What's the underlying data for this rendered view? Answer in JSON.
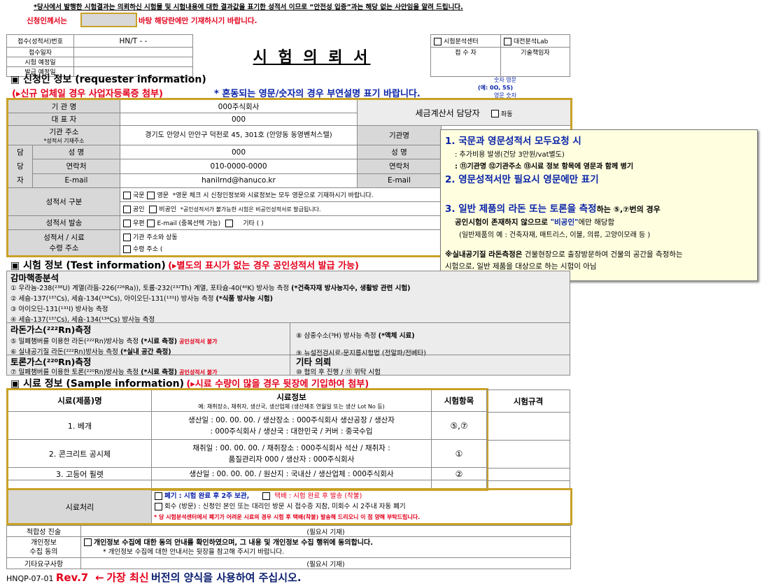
{
  "top_notice": "*당사에서 발행한 시험결과는 의뢰하신 시험물 및 시험내용에 대한 결과값을 표기한 성적서 이므로 “안전성 입증”과는 해당 없는 사안임을 알려 드립니다.",
  "applicant_note": {
    "before": "신청인께서는",
    "after": "바탕 해당란에만 기재하시기 바랍니다."
  },
  "header": {
    "receipt_no_label": "접수(성적서)번호",
    "receipt_no_value": "HN/T -        -",
    "receipt_date_label": "접수일자",
    "test_date_label": "시험 예정일",
    "issue_date_label": "발급 예정일",
    "title": "시 험 의 뢰 서",
    "center_label": "시험분석센터",
    "receiver_label": "접 수 자",
    "lab_label": "대전분석Lab",
    "tech_label": "기술책임자"
  },
  "requester_section": {
    "title": "▣ 신청인 정보 (requester information)",
    "warning": "(▸신규 업체일 경우 사업자등록증 첨부)",
    "eng_note": "* 혼동되는 영문/숫자의 경우 부연설명 표기 바랍니다.",
    "example_top": "숫자    영문",
    "example_mid": "(예: 0O,    5S)",
    "example_bottom": "영문    숫자"
  },
  "requester": {
    "org_label": "기 관 명",
    "org_value": "000주식회사",
    "ceo_label": "대 표 자",
    "ceo_value": "000",
    "addr_label": "기관 주소",
    "addr_sub": "*성적서 기재주소",
    "addr_value": "경기도 안양시 만안구 덕천로 45, 301호 (안양동 동영벤처스텔)",
    "contact_side": "담당자",
    "name_label": "성 명",
    "name_value": "000",
    "phone_label": "연락처",
    "phone_value": "010-0000-0000",
    "email_label": "E-mail",
    "email_value": "hanilrnd@hanuco.kr",
    "tax_label": "세금계산서 담당자",
    "tax_same": "좌동",
    "r_org_label": "기관명",
    "r_name_label": "성 명",
    "r_phone_label": "연락처",
    "r_email_label": "E-mail"
  },
  "report": {
    "type_label": "성적서 구분",
    "kor": "국문",
    "eng": "영문",
    "eng_note": "*영문 체크 시 신청인정보와 시료정보는 모두 영문으로 기재하시기 바랍니다.",
    "official": "공인",
    "unofficial": "비공인",
    "official_note": "*공인성적서가 불가능한 시험은 비공인성적서로 발급됩니다.",
    "send_label": "성적서 발송",
    "mail": "우편",
    "email_dup": "E-mail (중복선택 가능)",
    "other": "기타 (                    )",
    "recv_label1": "성적서 / 시료",
    "recv_label2": "수령 주소",
    "recv_opt1": "기관 주소와 상동",
    "recv_opt2": "수령 주소 ("
  },
  "popup": {
    "l1": "1. 국문과 영문성적서 모두요청 시",
    "l2": ": 추가비용 발생(건당 3만원/vat별도)",
    "l3": ": ⑪기관명  ⑫기관주소   ⑬시료 정보   항목에 영문과 함께 병기",
    "l4": "2. 영문성적서만 필요시 영문에만 표기",
    "l5a": "3. 일반 제품의 라돈 또는 토론을 측정",
    "l5b": "하는 ⑤,⑦번의 경우",
    "l6a": "공인시험이 존재하지 않으므로 ",
    "l6b": "\"비공인\"",
    "l6c": "에만 해당함",
    "l7": "(일반제품의 예 : 건축자재, 매트리스, 이불, 의류, 고양이모래 등 )",
    "l8a": "※실내공기질 라돈측정은",
    "l8b": " 건물현장으로 출장방문하여 건물의 공간을 측정하는",
    "l9": "시험으로, 일반 제품을 대상으로 하는 시험이 아님"
  },
  "test_section": {
    "title": "▣ 시험 정보 (Test information)",
    "note": "(▸별도의 표시가 없는 경우 공인성적서 발급 가능)",
    "gamma_title": "감마핵종분석",
    "g1a": "① 우라늄-238(²³⁸U) 계열(라듐-226(²²⁶Ra)), 토륨-232(²³²Th) 계열, 포타슘-40(⁴⁰K) 방사능 측정 ",
    "g1b": "(*건축자재 방사능지수, 생활방 관련 시험)",
    "g2a": "② 세슘-137(¹³⁷Cs), 세슘-134(¹³⁴Cs), 아이오딘-131(¹³¹I) 방사능 측정 ",
    "g2b": "(*식품 방사능 시험)",
    "g3": "③ 아이오딘-131(¹³¹I) 방사능 측정",
    "g4": "④ 세슘-137(¹³⁷Cs), 세슘-134(¹³⁴Cs) 방사능 측정",
    "radon_title": "라돈가스(²²²Rn)측정",
    "r5a": "⑤ 밀폐챔버를 이용한 라돈(²²²Rn)방사능 측정 ",
    "r5b": "(*시료 측정)",
    "r5c": "공인성적서 불가",
    "r6a": "⑥ 실내공기질 라돈(²²²Rn)방사능 측정 ",
    "r6b": "(*실내 공간 측정)",
    "h8a": "⑧ 삼중수소(³H) 방사능 측정 ",
    "h8b": "(*액체 시료)",
    "h9": "⑨ 뉴설전검시료-문지름시험법 (전알파/전베타)",
    "thoron_title": "토론가스(²²⁰Rn)측정",
    "t7a": "⑦ 밀폐챔버를 이용한 토론(²²⁰Rn)방사능 측정 ",
    "t7b": "(*시료 측정)",
    "t7c": "공인성적서 불가",
    "other_title": "기타 의뢰",
    "other_items": "⑩ 협의 후 진행  /   ⑪ 위탁 시험"
  },
  "sample_section": {
    "title": "▣ 시료 정보 (Sample information)",
    "note": "(▸시료 수량이 많을 경우 뒷장에 기입하여 첨부)",
    "col_name": "시료(제품)명",
    "col_info": "시료정보",
    "col_info_sub": "예: 채취장소, 채취자, 생산국, 생산업체 (생산제조 연월일 또는 생산 Lot No 등)",
    "col_item": "시험항목",
    "col_std": "시험규격",
    "rows": [
      {
        "name": "1. 베개",
        "info1": "생산일 : 00. 00. 00. / 생산장소 : 000주식회사 생산공장 / 생산자",
        "info2": ": 000주식회사 / 생산국 : 대한민국 / 커버 : 중국수입",
        "item": "⑤,⑦"
      },
      {
        "name": "2. 콘크리트 공시체",
        "info1": "채취일 : 00. 00. 00. / 채취장소 : 000주식회사 석산 / 채취자 :",
        "info2": "품질관리자 000 / 생산자 : 000주식회사",
        "item": "①"
      },
      {
        "name": "3. 고등어 필렛",
        "info1": "생산일 : 00. 00. 00. / 원산지 : 국내산 / 생산업체 : 000주식회사",
        "info2": "",
        "item": "②"
      }
    ]
  },
  "disposal": {
    "label": "시료처리",
    "o1a": "폐기 : 시험 완료 후 2주 보관,",
    "o1b": "택배 : 시험 완료 후 발송 (착불)",
    "o2": "회수 (방문) : 신청인 본인 또는 대리인 방문 시 접수증 지참, 미회수 시 2주내 자동 폐기",
    "o3": "* 당 시험분석센터에서 폐기가 어려운 시료의 경우 시험 후 택배(착불) 발송해 드리오니 이 점 양해 부탁드립니다."
  },
  "footer_rows": {
    "fit_label": "적합성 진술",
    "fit_value": "(필요시 기재)",
    "privacy_label1": "개인정보",
    "privacy_label2": "수집 동의",
    "privacy_text": "개인정보 수집에 대한 동의 안내를 확인하였으며, 그 내용 및 개인정보 수집 행위에 동의합니다.",
    "privacy_sub": "* 개인정보 수집에 대한 안내서는 뒷장을 참고해 주시기 바랍니다.",
    "other_label": "기타요구사항",
    "other_value": "(필요시 기재)"
  },
  "bottom": {
    "form_no": "HNQP-07-01",
    "rev": "Rev.7",
    "arrow": "←",
    "latest": "가장 최신",
    "rest": "버전의 양식을 사용하여 주십시오."
  },
  "colors": {
    "red": "#e4001b",
    "gold": "#c9a227",
    "gray": "#d8d8d8",
    "popup": "#ffffe0"
  }
}
